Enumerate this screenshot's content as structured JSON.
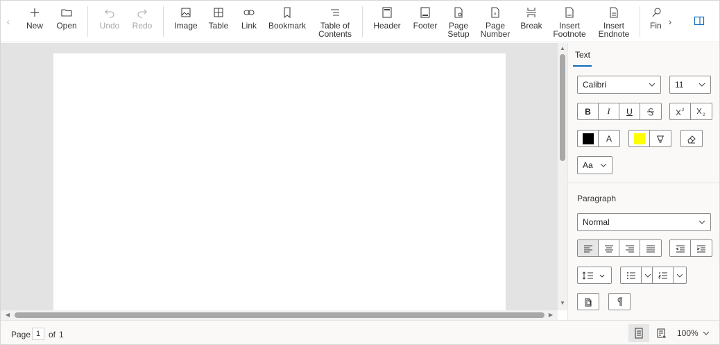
{
  "toolbar": {
    "new": "New",
    "open": "Open",
    "undo": "Undo",
    "redo": "Redo",
    "image": "Image",
    "table": "Table",
    "link": "Link",
    "bookmark": "Bookmark",
    "toc_line1": "Table of",
    "toc_line2": "Contents",
    "header": "Header",
    "footer": "Footer",
    "page_setup_line1": "Page",
    "page_setup_line2": "Setup",
    "page_number_line1": "Page",
    "page_number_line2": "Number",
    "break": "Break",
    "insert_footnote_line1": "Insert",
    "insert_footnote_line2": "Footnote",
    "insert_endnote_line1": "Insert",
    "insert_endnote_line2": "Endnote",
    "find": "Fin"
  },
  "panel": {
    "tab": "Text",
    "font_family": "Calibri",
    "font_size": "11",
    "bold": "B",
    "italic": "I",
    "underline": "U",
    "font_color_letter": "A",
    "change_case": "Aa",
    "paragraph_title": "Paragraph",
    "style": "Normal"
  },
  "status": {
    "page_label": "Page",
    "current_page": "1",
    "of_label": "of",
    "total_pages": "1",
    "zoom": "100%"
  },
  "colors": {
    "font_color": "#000000",
    "highlight_color": "#ffff00",
    "accent": "#0f6cbd"
  }
}
